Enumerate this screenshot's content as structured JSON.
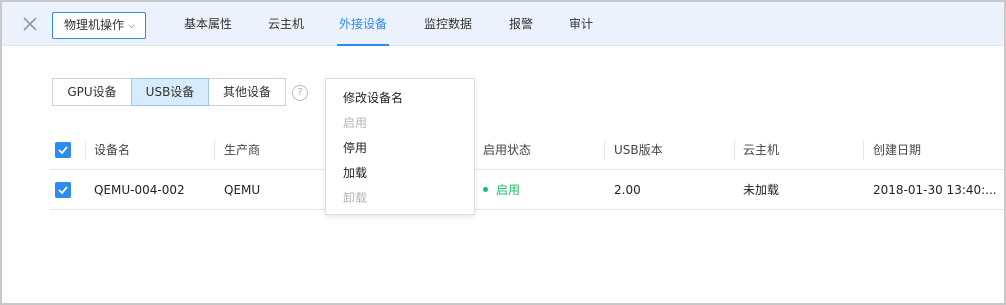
{
  "header": {
    "ops_button_label": "物理机操作",
    "ops_caret": "⌵",
    "tabs": [
      {
        "label": "基本属性"
      },
      {
        "label": "云主机"
      },
      {
        "label": "外接设备"
      },
      {
        "label": "监控数据"
      },
      {
        "label": "报警"
      },
      {
        "label": "审计"
      }
    ],
    "active_tab": "外接设备"
  },
  "device_types": [
    {
      "label": "GPU设备"
    },
    {
      "label": "USB设备"
    },
    {
      "label": "其他设备"
    }
  ],
  "active_device_type": "USB设备",
  "help_glyph": "?",
  "table": {
    "columns": [
      "设备名",
      "生产商",
      "启用状态",
      "USB版本",
      "云主机",
      "创建日期"
    ],
    "rows": [
      {
        "name": "QEMU-004-002",
        "vendor": "QEMU",
        "status": "启用",
        "usb_version": "2.00",
        "vm": "未加载",
        "created": "2018-01-30 13:40:..."
      }
    ]
  },
  "context_menu": {
    "items": [
      {
        "label": "修改设备名",
        "enabled": true
      },
      {
        "label": "启用",
        "enabled": false
      },
      {
        "label": "停用",
        "enabled": true
      },
      {
        "label": "加载",
        "enabled": true
      },
      {
        "label": "卸载",
        "enabled": false
      }
    ]
  },
  "colors": {
    "accent": "#2d8cf0",
    "header_bg": "#ecf2fb",
    "status_enabled": "#19be6b",
    "disabled_text": "#b4b4b4"
  },
  "icons": {
    "close": "close-icon",
    "caret": "chevron-down-icon",
    "help": "question-circle-icon",
    "checkbox": "checkbox-checked-icon",
    "status": "status-dot-icon"
  }
}
